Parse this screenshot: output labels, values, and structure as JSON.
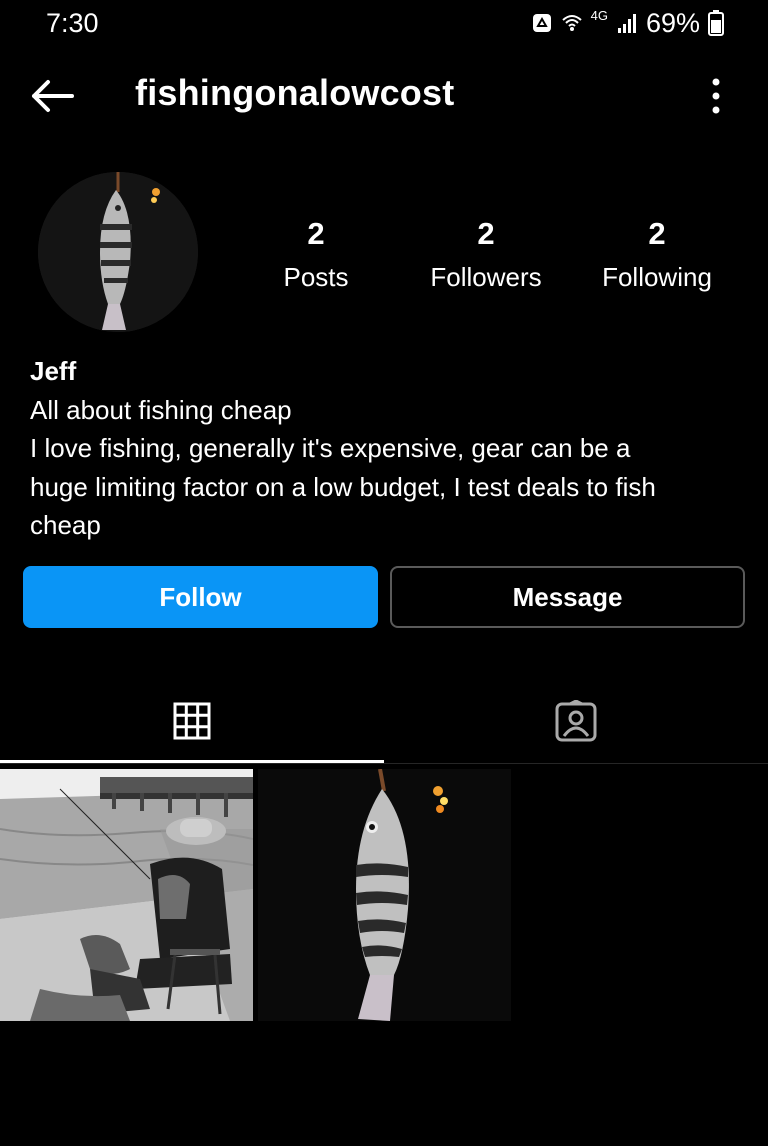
{
  "status_bar": {
    "time": "7:30",
    "network": "4G",
    "battery": "69%",
    "icons": [
      "recycle-notification-icon",
      "wifi-calling-icon",
      "signal-icon",
      "battery-icon"
    ]
  },
  "header": {
    "username": "fishingonalowcost",
    "back_icon": "arrow-left-icon",
    "more_icon": "more-vertical-icon"
  },
  "stats": [
    {
      "count": "2",
      "label": "Posts"
    },
    {
      "count": "2",
      "label": "Followers"
    },
    {
      "count": "2",
      "label": "Following"
    }
  ],
  "bio": {
    "name": "Jeff",
    "line1": "All about fishing cheap",
    "line2": "I love fishing, generally it's expensive, gear can be a",
    "line3": "huge limiting factor on a low budget, I test deals to fish",
    "line4": "cheap"
  },
  "actions": {
    "follow": "Follow",
    "message": "Message"
  },
  "tabs": [
    {
      "icon": "grid-icon",
      "active": true
    },
    {
      "icon": "tagged-person-icon",
      "active": false
    }
  ],
  "colors": {
    "background": "#000000",
    "follow_button": "#0A95F6",
    "message_border": "#5A5A5A"
  }
}
